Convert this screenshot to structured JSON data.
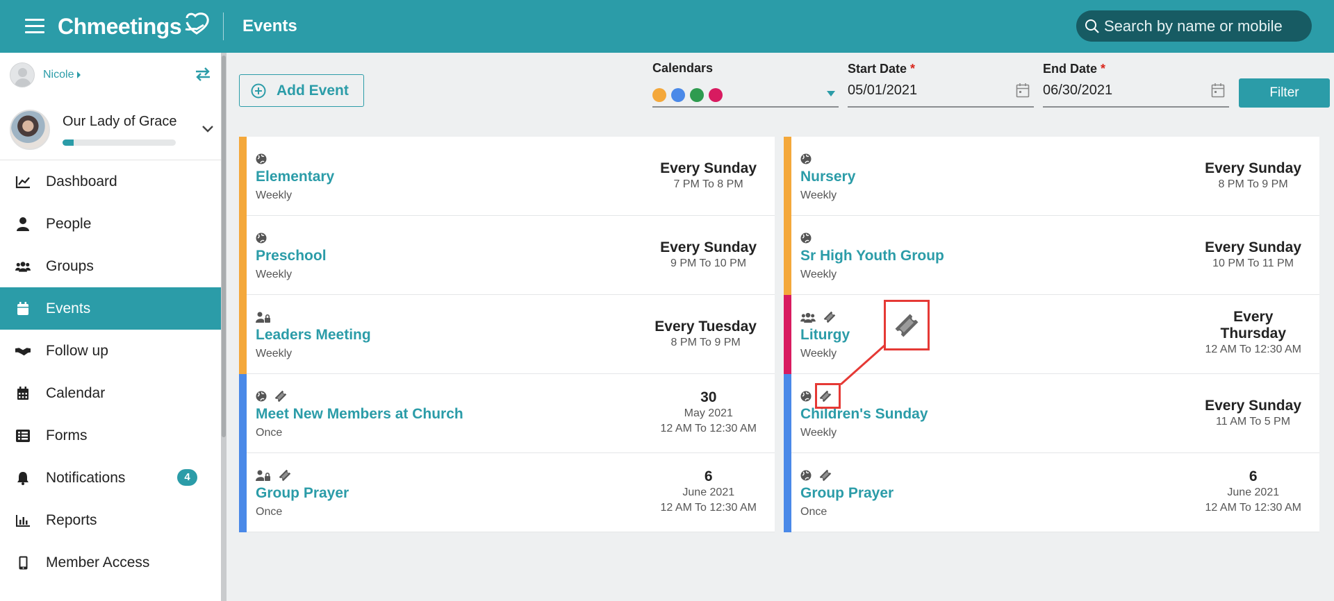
{
  "header": {
    "app_name": "Chmeetings",
    "page_title": "Events",
    "search_placeholder": "Search by name or mobile"
  },
  "sidebar": {
    "user": "Nicole",
    "org_name": "Our Lady of Grace",
    "org_progress": 0.1,
    "items": [
      {
        "label": "Dashboard",
        "icon": "chart-line-icon"
      },
      {
        "label": "People",
        "icon": "person-icon"
      },
      {
        "label": "Groups",
        "icon": "users-icon"
      },
      {
        "label": "Events",
        "icon": "calendar-icon",
        "active": true
      },
      {
        "label": "Follow up",
        "icon": "handshake-icon"
      },
      {
        "label": "Calendar",
        "icon": "calendar-grid-icon"
      },
      {
        "label": "Forms",
        "icon": "list-icon"
      },
      {
        "label": "Notifications",
        "icon": "bell-icon",
        "badge": "4"
      },
      {
        "label": "Reports",
        "icon": "bar-chart-icon"
      },
      {
        "label": "Member Access",
        "icon": "mobile-icon"
      }
    ]
  },
  "toolbar": {
    "add_event": "Add Event",
    "calendars_label": "Calendars",
    "calendar_colors": [
      "#f4a83b",
      "#4a89e8",
      "#2e9b4f",
      "#d81b60"
    ],
    "start_date_label": "Start Date",
    "start_date": "05/01/2021",
    "end_date_label": "End Date",
    "end_date": "06/30/2021",
    "required_mark": "*",
    "filter": "Filter"
  },
  "colors": {
    "accent": "#2b9ca8",
    "orange": "#f4a83b",
    "blue": "#4a89e8",
    "crimson": "#d81b60",
    "highlight": "#e53935"
  },
  "events_left": [
    {
      "title": "Elementary",
      "freq": "Weekly",
      "when_main": "Every Sunday",
      "when_sub": "7 PM To 8 PM",
      "stripe": "#f4a83b",
      "icons": [
        "globe-icon"
      ]
    },
    {
      "title": "Preschool",
      "freq": "Weekly",
      "when_main": "Every Sunday",
      "when_sub": "9 PM To 10 PM",
      "stripe": "#f4a83b",
      "icons": [
        "globe-icon"
      ]
    },
    {
      "title": "Leaders Meeting",
      "freq": "Weekly",
      "when_main": "Every Tuesday",
      "when_sub": "8 PM To 9 PM",
      "stripe": "#f4a83b",
      "icons": [
        "user-lock-icon"
      ]
    },
    {
      "title": "Meet New Members at Church",
      "freq": "Once",
      "when_main": "30",
      "when_sub": "May 2021",
      "when_sub2": "12 AM To 12:30 AM",
      "stripe": "#4a89e8",
      "icons": [
        "globe-icon",
        "ticket-icon"
      ]
    },
    {
      "title": "Group Prayer",
      "freq": "Once",
      "when_main": "6",
      "when_sub": "June 2021",
      "when_sub2": "12 AM To 12:30 AM",
      "stripe": "#4a89e8",
      "icons": [
        "user-lock-icon",
        "ticket-icon"
      ]
    }
  ],
  "events_right": [
    {
      "title": "Nursery",
      "freq": "Weekly",
      "when_main": "Every Sunday",
      "when_sub": "8 PM To 9 PM",
      "stripe": "#f4a83b",
      "icons": [
        "globe-icon"
      ]
    },
    {
      "title": "Sr High Youth Group",
      "freq": "Weekly",
      "when_main": "Every Sunday",
      "when_sub": "10 PM To 11 PM",
      "stripe": "#f4a83b",
      "icons": [
        "globe-icon"
      ]
    },
    {
      "title": "Liturgy",
      "freq": "Weekly",
      "when_main": "Every Thursday",
      "when_sub": "12 AM To 12:30 AM",
      "stripe": "#d81b60",
      "icons": [
        "users-icon",
        "ticket-icon"
      ]
    },
    {
      "title": "Children's Sunday",
      "freq": "Weekly",
      "when_main": "Every Sunday",
      "when_sub": "11 AM To 5 PM",
      "stripe": "#4a89e8",
      "icons": [
        "globe-icon",
        "ticket-icon"
      ]
    },
    {
      "title": "Group Prayer",
      "freq": "Once",
      "when_main": "6",
      "when_sub": "June 2021",
      "when_sub2": "12 AM To 12:30 AM",
      "stripe": "#4a89e8",
      "icons": [
        "globe-icon",
        "ticket-icon"
      ]
    }
  ]
}
